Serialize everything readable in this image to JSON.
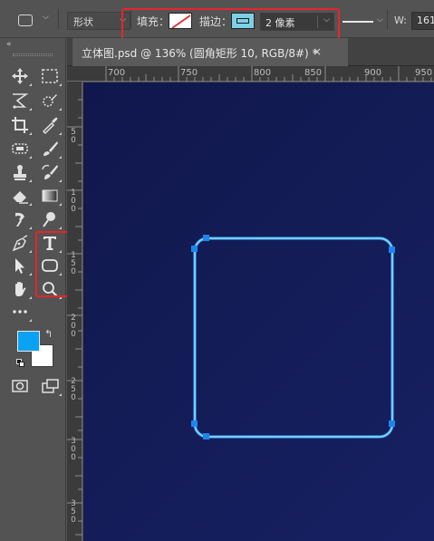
{
  "options_bar": {
    "mode": "形状",
    "fill_label": "填充：",
    "stroke_label": "描边：",
    "stroke_width": "2 像素",
    "width_label": "W:",
    "width_value": "161",
    "fill_color": "none",
    "stroke_color": "#7dd0e6"
  },
  "toolbar": {
    "collapse_glyph": "«",
    "tools": [
      {
        "name": "move-tool-icon",
        "row": 0,
        "col": 0
      },
      {
        "name": "rectangular-marquee-tool-icon",
        "row": 0,
        "col": 1
      },
      {
        "name": "lasso-tool-icon",
        "row": 1,
        "col": 0
      },
      {
        "name": "quick-selection-tool-icon",
        "row": 1,
        "col": 1
      },
      {
        "name": "crop-tool-icon",
        "row": 2,
        "col": 0
      },
      {
        "name": "eyedropper-tool-icon",
        "row": 2,
        "col": 1
      },
      {
        "name": "spot-healing-brush-icon",
        "row": 3,
        "col": 0
      },
      {
        "name": "brush-tool-icon",
        "row": 3,
        "col": 1
      },
      {
        "name": "clone-stamp-icon",
        "row": 4,
        "col": 0
      },
      {
        "name": "history-brush-icon",
        "row": 4,
        "col": 1
      },
      {
        "name": "eraser-tool-icon",
        "row": 5,
        "col": 0
      },
      {
        "name": "gradient-tool-icon",
        "row": 5,
        "col": 1
      },
      {
        "name": "smudge-tool-icon",
        "row": 6,
        "col": 0
      },
      {
        "name": "dodge-tool-icon",
        "row": 6,
        "col": 1
      },
      {
        "name": "pen-tool-icon",
        "row": 7,
        "col": 0
      },
      {
        "name": "type-tool-icon",
        "row": 7,
        "col": 1
      },
      {
        "name": "path-selection-tool-icon",
        "row": 8,
        "col": 0
      },
      {
        "name": "rounded-rectangle-tool-icon",
        "row": 8,
        "col": 1
      },
      {
        "name": "hand-tool-icon",
        "row": 9,
        "col": 0
      },
      {
        "name": "zoom-tool-icon",
        "row": 9,
        "col": 1
      },
      {
        "name": "more-tools-icon",
        "row": 10,
        "col": 0
      }
    ],
    "foreground_color": "#0aa2f2",
    "background_color": "#ffffff",
    "swap_glyph": "↰"
  },
  "document": {
    "tab_title": "立体图.psd @ 136% (圆角矩形 10, RGB/8#) *",
    "close_glyph": "×"
  },
  "rulers": {
    "top_ticks": [
      "700",
      "750",
      "800",
      "850",
      "900",
      "950"
    ],
    "left_ticks": [
      [
        "5",
        "0"
      ],
      [
        "1",
        "0",
        "0"
      ],
      [
        "1",
        "5",
        "0"
      ],
      [
        "2",
        "0",
        "0"
      ],
      [
        "2",
        "5",
        "0"
      ],
      [
        "3",
        "0",
        "0"
      ],
      [
        "3",
        "5",
        "0"
      ]
    ]
  },
  "canvas": {
    "background_color": "#131b55",
    "shape_stroke_color": "#62c8f6",
    "handle_color": "#1c7fe6"
  }
}
